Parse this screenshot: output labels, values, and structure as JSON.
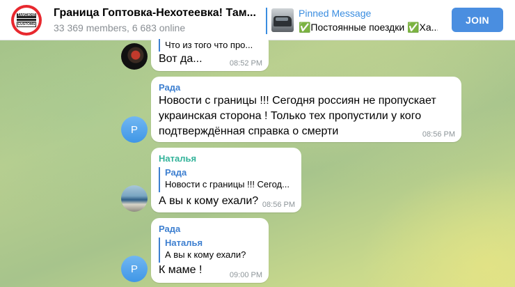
{
  "header": {
    "title": "Граница Гоптовка-Нехотеевка! Там...",
    "subtitle": "33 369 members, 6 683 online",
    "avatar_text_top": "ТАМОЖНЯ",
    "avatar_text_bottom": "CUSTOMS",
    "pinned_label": "Pinned Message",
    "pinned_text": "✅Постоянные поездки ✅Ха...",
    "join_label": "JOIN",
    "accent_color": "#3a8de0"
  },
  "messages": [
    {
      "reply_text": "Что из того что про...",
      "text": "Вот да...",
      "time": "08:52 PM"
    },
    {
      "sender": "Рада",
      "avatar_letter": "Р",
      "text_lines": [
        "Новости с границы !!! Сегодня россиян не пропускает",
        "украинская сторона ! Только тех пропустили у кого",
        "подтверждённая справка о смерти"
      ],
      "time": "08:56 PM"
    },
    {
      "sender": "Наталья",
      "reply_name": "Рада",
      "reply_text": "Новости с границы !!! Сегод...",
      "text": "А вы к кому ехали?",
      "time": "08:56 PM"
    },
    {
      "sender": "Рада",
      "avatar_letter": "Р",
      "reply_name": "Наталья",
      "reply_text": "А вы к кому ехали?",
      "text": "К маме !",
      "time": "09:00 PM"
    }
  ]
}
